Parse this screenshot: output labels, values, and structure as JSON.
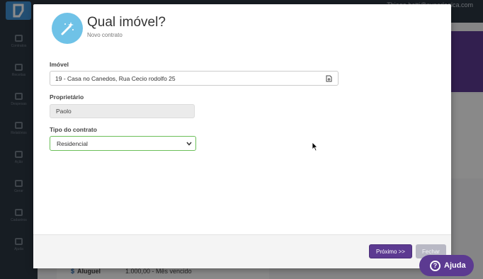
{
  "background": {
    "user": "Thiago betti@superlogica.com",
    "sidebar": [
      "Contratos",
      "Receitas",
      "Despesas",
      "Relatórios",
      "Ação",
      "Gerar",
      "Cadastros",
      "Ajuda"
    ],
    "row": {
      "label": "Aluguel",
      "value": "1.000,00 - Mês vencido"
    }
  },
  "modal": {
    "title": "Qual imóvel?",
    "subtitle": "Novo contrato",
    "imovel": {
      "label": "Imóvel",
      "value": "19 - Casa no Canedos, Rua Cecio rodolfo 25"
    },
    "proprietario": {
      "label": "Proprietário",
      "value": "Paolo"
    },
    "tipo": {
      "label": "Tipo do contrato",
      "value": "Residencial"
    },
    "buttons": {
      "next": "Próximo >>",
      "close": "Fechar"
    }
  },
  "help": {
    "label": "Ajuda"
  },
  "colors": {
    "primary": "#5c3a91",
    "icon_bg": "#6fc2e7",
    "select_border": "#6bbf59"
  }
}
